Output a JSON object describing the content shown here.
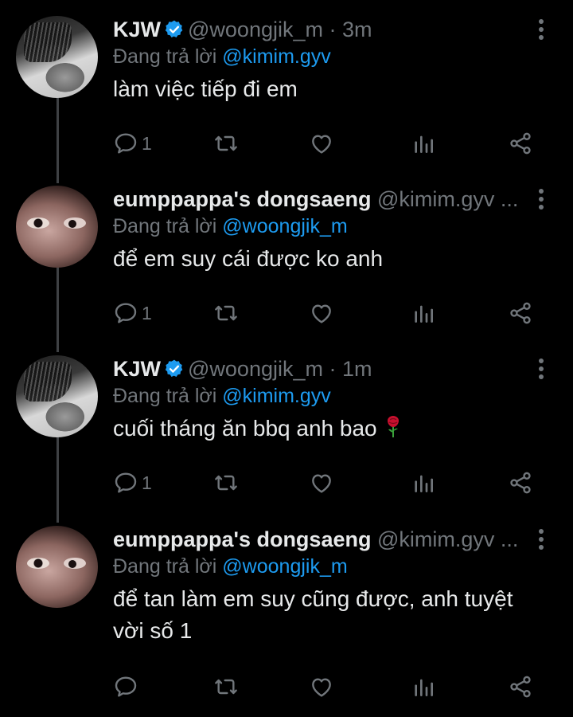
{
  "colors": {
    "background": "#000000",
    "text": "#e7e9ea",
    "muted": "#71767b",
    "accent": "#1d9bf0",
    "thread_line": "#3e4144"
  },
  "reply_prefix": "Đang trả lời",
  "tweets": [
    {
      "name": "KJW",
      "verified": true,
      "handle": "@woongjik_m · 3m",
      "reply_to": "@kimim.gyv",
      "text": "làm việc tiếp đi em",
      "reply_count": "1",
      "avatar": "kjw-avatar"
    },
    {
      "name": "eumppappa's dongsaeng",
      "verified": false,
      "handle": "@kimim.gyv ...",
      "reply_to": "@woongjik_m",
      "text": "để em suy cái được ko anh",
      "reply_count": "1",
      "avatar": "eumppappa-avatar"
    },
    {
      "name": "KJW",
      "verified": true,
      "handle": "@woongjik_m · 1m",
      "reply_to": "@kimim.gyv",
      "text": "cuối tháng ăn bbq anh bao",
      "emoji": "rose-icon",
      "reply_count": "1",
      "avatar": "kjw-avatar"
    },
    {
      "name": "eumppappa's dongsaeng",
      "verified": false,
      "handle": "@kimim.gyv ...",
      "reply_to": "@woongjik_m",
      "text": "để tan làm em suy cũng được, anh tuyệt vời số 1",
      "reply_count": "",
      "avatar": "eumppappa-avatar"
    }
  ],
  "icons": [
    "reply-icon",
    "retweet-icon",
    "like-icon",
    "views-icon",
    "share-icon",
    "more-options-icon",
    "verified-badge-icon"
  ]
}
